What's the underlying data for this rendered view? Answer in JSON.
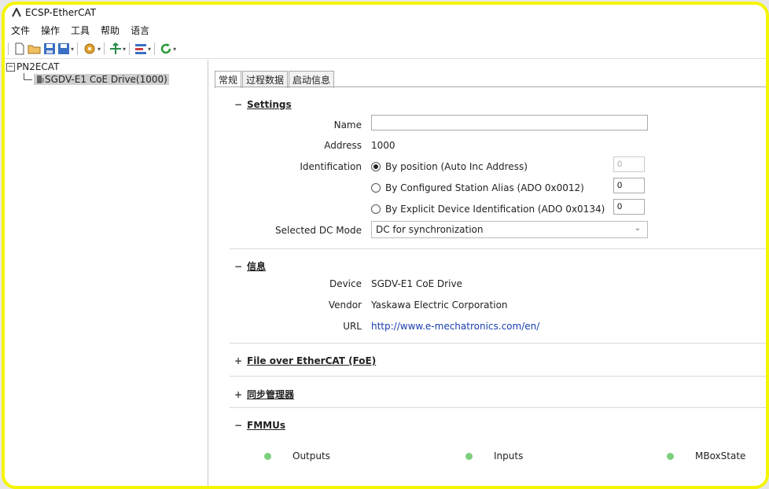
{
  "window": {
    "title": "ECSP-EtherCAT"
  },
  "menu": [
    "文件",
    "操作",
    "工具",
    "帮助",
    "语言"
  ],
  "toolbar": {
    "icons": [
      "new-file-icon",
      "open-folder-icon",
      "save-icon",
      "save-as-icon",
      "settings-gear-icon",
      "move-arrows-icon",
      "network-config-icon",
      "refresh-icon"
    ]
  },
  "tree": {
    "root": "PN2ECAT",
    "root_toggle": "−",
    "child": "SGDV-E1 CoE Drive(1000)"
  },
  "tabs": [
    "常规",
    "过程数据",
    "启动信息"
  ],
  "settings": {
    "header": "Settings",
    "toggle": "−",
    "name_label": "Name",
    "name_value": "",
    "address_label": "Address",
    "address_value": "1000",
    "identification_label": "Identification",
    "options": [
      {
        "label": "By position (Auto Inc Address)",
        "value": "0",
        "selected": true
      },
      {
        "label": "By Configured Station Alias (ADO 0x0012)",
        "value": "0",
        "selected": false
      },
      {
        "label": "By Explicit Device Identification (ADO 0x0134)",
        "value": "0",
        "selected": false
      }
    ],
    "dc_label": "Selected DC Mode",
    "dc_value": "DC for synchronization"
  },
  "info": {
    "header": "信息",
    "toggle": "−",
    "device_label": "Device",
    "device_value": "SGDV-E1 CoE Drive",
    "vendor_label": "Vendor",
    "vendor_value": "Yaskawa Electric Corporation",
    "url_label": "URL",
    "url_value": "http://www.e-mechatronics.com/en/"
  },
  "foe": {
    "header": "File over EtherCAT (FoE)",
    "toggle": "+"
  },
  "sync": {
    "header": "同步管理器",
    "toggle": "+"
  },
  "fmmus": {
    "header": "FMMUs",
    "toggle": "−",
    "items": [
      "Outputs",
      "Inputs",
      "MBoxState"
    ]
  },
  "colors": {
    "accent_border": "#f5f500",
    "led": "#7ccf7c",
    "link": "#1a3fb0"
  }
}
